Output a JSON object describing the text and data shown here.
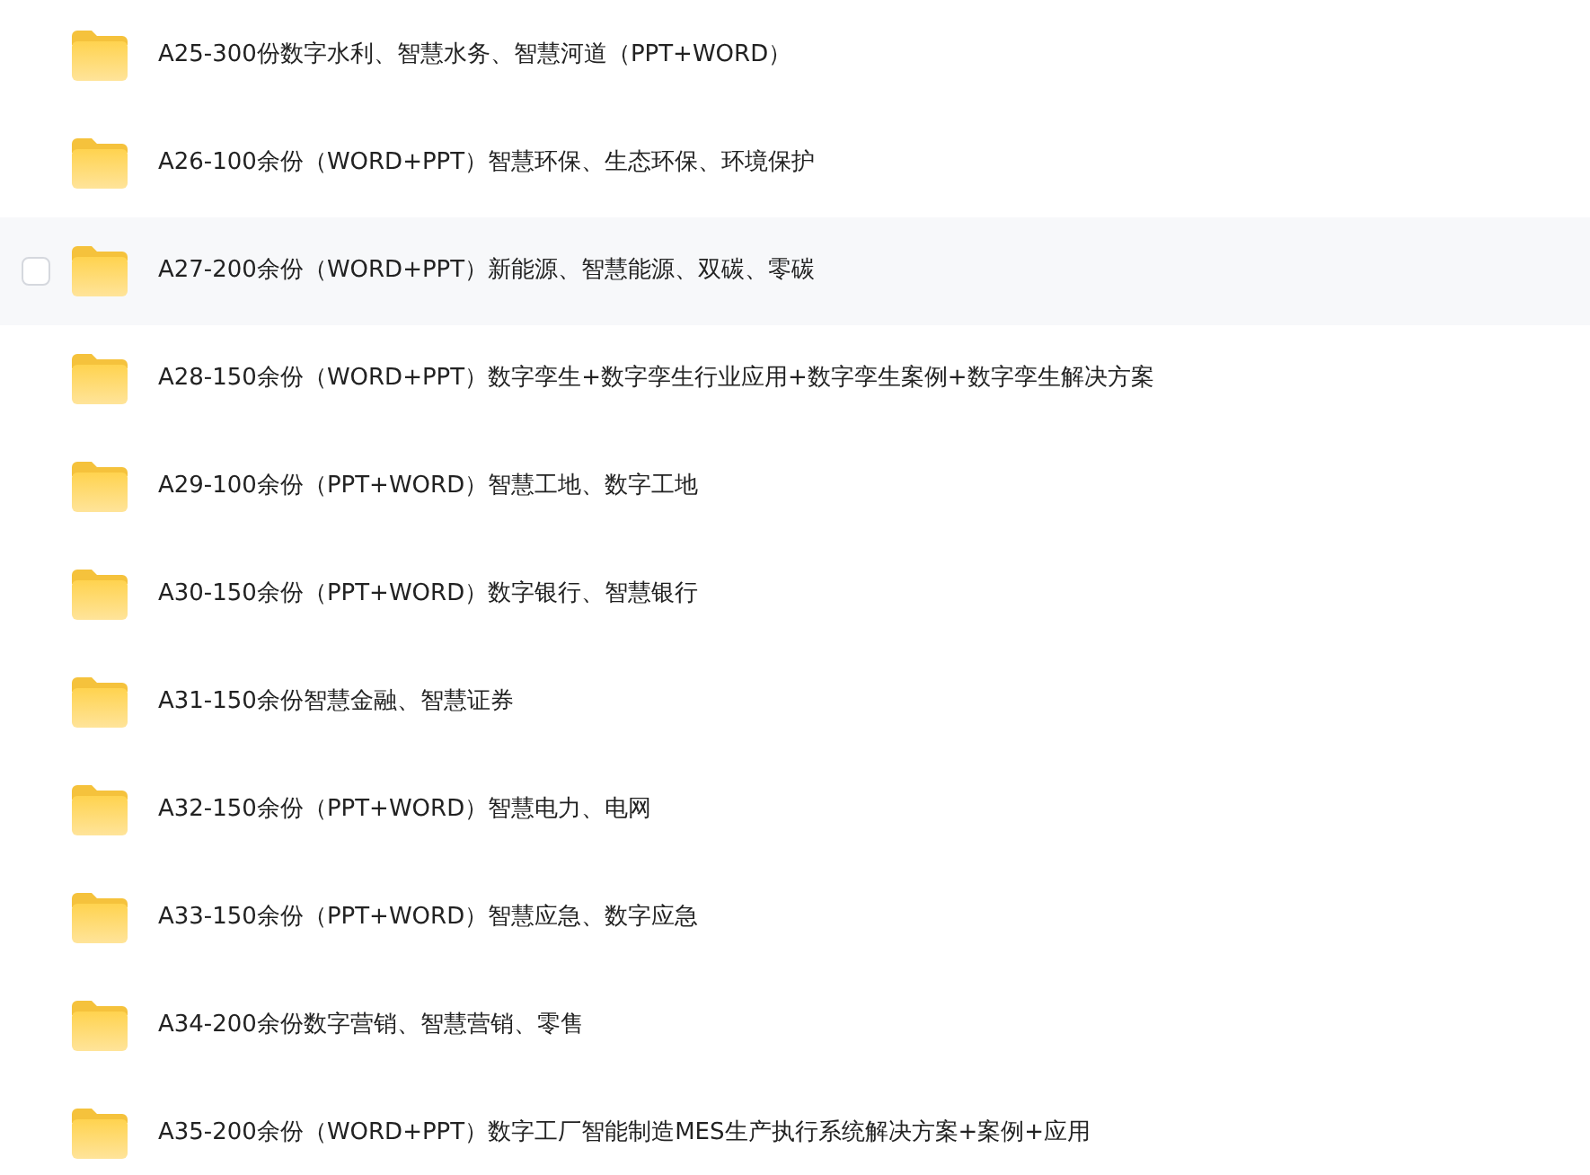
{
  "files": [
    {
      "label": "A25-300份数字水利、智慧水务、智慧河道（PPT+WORD）",
      "hovered": false
    },
    {
      "label": "A26-100余份（WORD+PPT）智慧环保、生态环保、环境保护",
      "hovered": false
    },
    {
      "label": "A27-200余份（WORD+PPT）新能源、智慧能源、双碳、零碳",
      "hovered": true
    },
    {
      "label": "A28-150余份（WORD+PPT）数字孪生+数字孪生行业应用+数字孪生案例+数字孪生解决方案",
      "hovered": false
    },
    {
      "label": "A29-100余份（PPT+WORD）智慧工地、数字工地",
      "hovered": false
    },
    {
      "label": "A30-150余份（PPT+WORD）数字银行、智慧银行",
      "hovered": false
    },
    {
      "label": "A31-150余份智慧金融、智慧证券",
      "hovered": false
    },
    {
      "label": "A32-150余份（PPT+WORD）智慧电力、电网",
      "hovered": false
    },
    {
      "label": "A33-150余份（PPT+WORD）智慧应急、数字应急",
      "hovered": false
    },
    {
      "label": "A34-200余份数字营销、智慧营销、零售",
      "hovered": false
    },
    {
      "label": "A35-200余份（WORD+PPT）数字工厂智能制造MES生产执行系统解决方案+案例+应用",
      "hovered": false
    }
  ]
}
